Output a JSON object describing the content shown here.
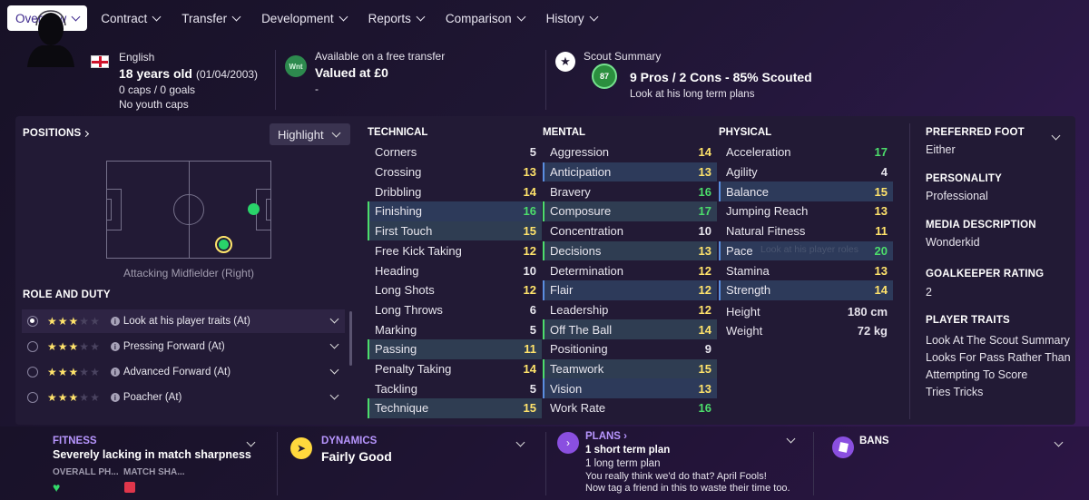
{
  "colors": {
    "accent": "#3f2a8e",
    "green": "#4cdd6b",
    "yellow": "#ffe36b",
    "purple": "#a98cff"
  },
  "tabs": [
    {
      "label": "Overview"
    },
    {
      "label": "Contract"
    },
    {
      "label": "Transfer"
    },
    {
      "label": "Development"
    },
    {
      "label": "Reports"
    },
    {
      "label": "Comparison"
    },
    {
      "label": "History"
    }
  ],
  "player": {
    "nationality": "English",
    "age": "18 years old",
    "dob": "(01/04/2003)",
    "caps": "0 caps / 0 goals",
    "youth": "No youth caps"
  },
  "transfer": {
    "badge": "Wnt",
    "status": "Available on a free transfer",
    "value": "Valued at £0",
    "sub": "-"
  },
  "scout": {
    "title": "Scout Summary",
    "rating": "87",
    "summary": "9 Pros / 2 Cons - 85% Scouted",
    "note": "Look at his long term plans"
  },
  "positions": {
    "title": "POSITIONS",
    "highlight": "Highlight",
    "position_label": "Attacking Midfielder (Right)"
  },
  "role_duty": {
    "title": "ROLE AND DUTY",
    "roles": [
      {
        "label": "Look at his player traits (At)",
        "selected": true
      },
      {
        "label": "Pressing Forward (At)",
        "selected": false
      },
      {
        "label": "Advanced Forward (At)",
        "selected": false
      },
      {
        "label": "Poacher (At)",
        "selected": false
      }
    ]
  },
  "technical": {
    "title": "TECHNICAL",
    "rows": [
      {
        "name": "Corners",
        "value": "5"
      },
      {
        "name": "Crossing",
        "value": "13"
      },
      {
        "name": "Dribbling",
        "value": "14"
      },
      {
        "name": "Finishing",
        "value": "16"
      },
      {
        "name": "First Touch",
        "value": "15"
      },
      {
        "name": "Free Kick Taking",
        "value": "12"
      },
      {
        "name": "Heading",
        "value": "10"
      },
      {
        "name": "Long Shots",
        "value": "12"
      },
      {
        "name": "Long Throws",
        "value": "6"
      },
      {
        "name": "Marking",
        "value": "5"
      },
      {
        "name": "Passing",
        "value": "11"
      },
      {
        "name": "Penalty Taking",
        "value": "14"
      },
      {
        "name": "Tackling",
        "value": "5"
      },
      {
        "name": "Technique",
        "value": "15"
      }
    ]
  },
  "mental": {
    "title": "MENTAL",
    "rows": [
      {
        "name": "Aggression",
        "value": "14"
      },
      {
        "name": "Anticipation",
        "value": "13"
      },
      {
        "name": "Bravery",
        "value": "16"
      },
      {
        "name": "Composure",
        "value": "17"
      },
      {
        "name": "Concentration",
        "value": "10"
      },
      {
        "name": "Decisions",
        "value": "13"
      },
      {
        "name": "Determination",
        "value": "12"
      },
      {
        "name": "Flair",
        "value": "12"
      },
      {
        "name": "Leadership",
        "value": "12"
      },
      {
        "name": "Off The Ball",
        "value": "14"
      },
      {
        "name": "Positioning",
        "value": "9"
      },
      {
        "name": "Teamwork",
        "value": "15"
      },
      {
        "name": "Vision",
        "value": "13"
      },
      {
        "name": "Work Rate",
        "value": "16"
      }
    ]
  },
  "physical": {
    "title": "PHYSICAL",
    "rows": [
      {
        "name": "Acceleration",
        "value": "17"
      },
      {
        "name": "Agility",
        "value": "4"
      },
      {
        "name": "Balance",
        "value": "15"
      },
      {
        "name": "Jumping Reach",
        "value": "13"
      },
      {
        "name": "Natural Fitness",
        "value": "11"
      },
      {
        "name": "Pace",
        "value": "20"
      },
      {
        "name": "Stamina",
        "value": "13"
      },
      {
        "name": "Strength",
        "value": "14"
      }
    ],
    "pace_overlay": "Look at his player roles",
    "height_label": "Height",
    "height": "180 cm",
    "weight_label": "Weight",
    "weight": "72 kg"
  },
  "info": {
    "foot_title": "PREFERRED FOOT",
    "foot": "Either",
    "personality_title": "PERSONALITY",
    "personality": "Professional",
    "media_title": "MEDIA DESCRIPTION",
    "media": "Wonderkid",
    "gk_title": "GOALKEEPER RATING",
    "gk": "2",
    "traits_title": "PLAYER TRAITS",
    "traits": [
      "Look At The Scout Summary",
      "Looks For Pass Rather Than",
      "Attempting To Score",
      "Tries Tricks"
    ]
  },
  "fitness": {
    "title": "FITNESS",
    "status": "Severely lacking in match sharpness",
    "sub1": "OVERALL PH...",
    "sub2": "MATCH SHA..."
  },
  "dynamics": {
    "title": "DYNAMICS",
    "value": "Fairly Good"
  },
  "plans": {
    "title": "PLANS",
    "line1": "1 short term plan",
    "line2": "1 long term plan",
    "line3": "You really think we'd do that? April Fools!",
    "line4": "Now tag a friend in this to waste their time too."
  },
  "bans": {
    "title": "BANS"
  }
}
